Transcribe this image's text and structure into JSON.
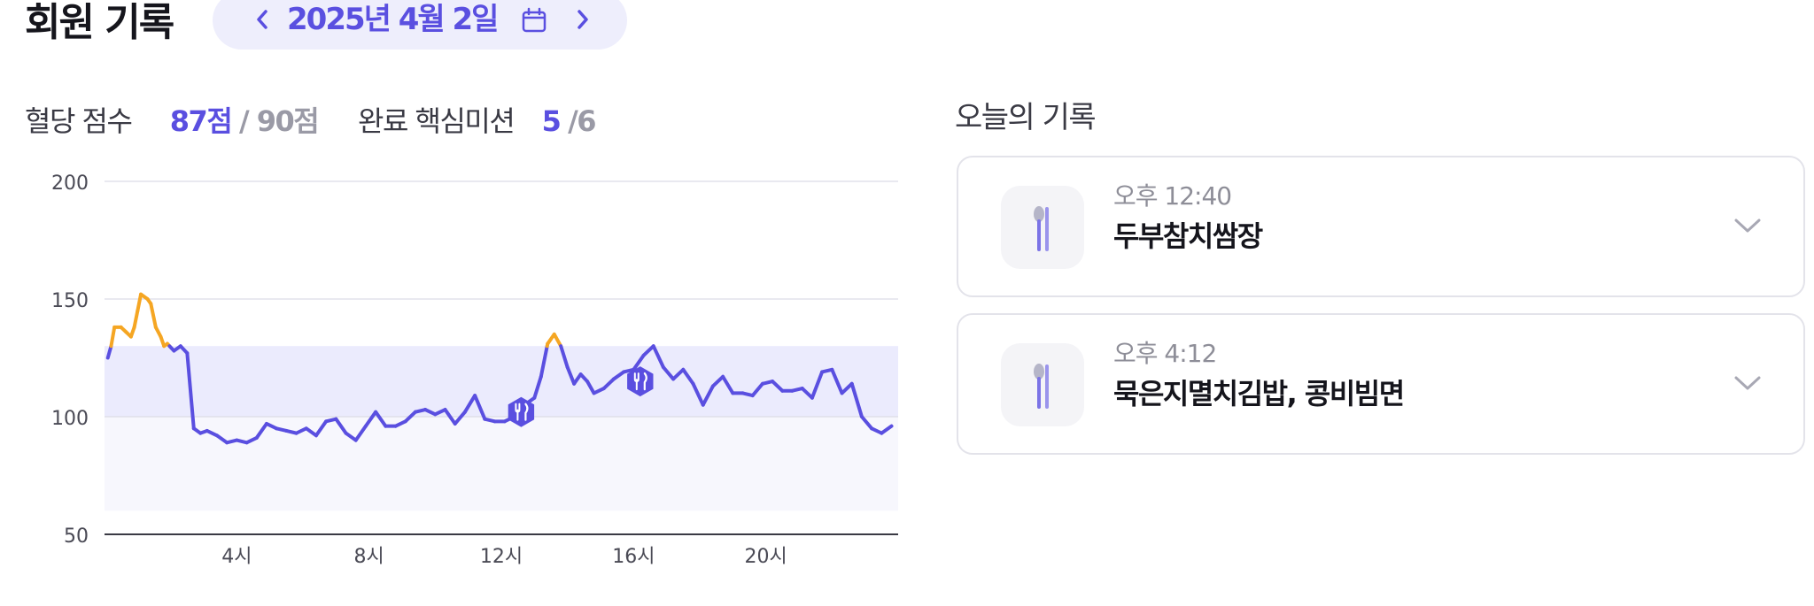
{
  "header": {
    "title": "회원 기록",
    "date_label": "2025년 4월 2일"
  },
  "stats": {
    "score_label": "혈당 점수",
    "score_value": "87점",
    "score_max": "/ 90점",
    "missions_label": "완료 핵심미션",
    "missions_value": "5",
    "missions_total": "/6"
  },
  "icons": {
    "prev": "chevron-left-icon",
    "next": "chevron-right-icon",
    "calendar": "calendar-icon",
    "meal": "fork-knife-icon",
    "expand": "chevron-down-icon"
  },
  "colors": {
    "accent": "#5a4fe0",
    "spike": "#f5a623",
    "target_band": "#ebebfd",
    "low_band": "#f7f7fd"
  },
  "chart_data": {
    "type": "line",
    "ylim": [
      50,
      200
    ],
    "yticks": [
      "200",
      "150",
      "100",
      "50"
    ],
    "xlim": [
      0,
      24
    ],
    "xticks": [
      {
        "x": 4,
        "label": "4시"
      },
      {
        "x": 8,
        "label": "8시"
      },
      {
        "x": 12,
        "label": "12시"
      },
      {
        "x": 16,
        "label": "16시"
      },
      {
        "x": 20,
        "label": "20시"
      }
    ],
    "target_range": [
      100,
      130
    ],
    "shaded_range": [
      60,
      100
    ],
    "spike_threshold": 130,
    "grid": true,
    "meal_markers": [
      {
        "x": 12.6,
        "y": 102
      },
      {
        "x": 16.2,
        "y": 115
      }
    ],
    "series": [
      {
        "x": [
          0.1,
          0.2,
          0.3,
          0.5,
          0.65,
          0.8,
          0.9,
          1.0,
          1.1,
          1.3,
          1.4,
          1.55,
          1.7,
          1.8,
          1.9,
          2.1,
          2.3,
          2.5,
          2.7,
          2.9,
          3.1,
          3.4,
          3.7,
          4.0,
          4.3,
          4.6,
          4.9,
          5.2,
          5.5,
          5.8,
          6.1,
          6.4,
          6.7,
          7.0,
          7.3,
          7.6,
          7.9,
          8.2,
          8.5,
          8.8,
          9.1,
          9.4,
          9.7,
          10.0,
          10.3,
          10.6,
          10.9,
          11.2,
          11.5,
          11.8,
          12.1,
          12.4,
          12.7,
          13.0,
          13.2,
          13.4,
          13.6,
          13.8,
          14.0,
          14.2,
          14.4,
          14.6,
          14.8,
          15.1,
          15.4,
          15.7,
          16.0,
          16.3,
          16.6,
          16.9,
          17.2,
          17.5,
          17.8,
          18.1,
          18.4,
          18.7,
          19.0,
          19.3,
          19.6,
          19.9,
          20.2,
          20.5,
          20.8,
          21.1,
          21.4,
          21.7,
          22.0,
          22.3,
          22.6,
          22.9,
          23.2,
          23.5,
          23.8
        ],
        "y": [
          125,
          130,
          138,
          138,
          136,
          134,
          138,
          145,
          152,
          150,
          148,
          138,
          134,
          130,
          131,
          128,
          130,
          127,
          95,
          93,
          94,
          92,
          89,
          90,
          89,
          91,
          97,
          95,
          94,
          93,
          95,
          92,
          98,
          99,
          93,
          90,
          96,
          102,
          96,
          96,
          98,
          102,
          103,
          101,
          103,
          97,
          102,
          109,
          99,
          98,
          98,
          100,
          105,
          108,
          117,
          131,
          135,
          130,
          121,
          114,
          118,
          115,
          110,
          112,
          116,
          119,
          120,
          126,
          130,
          121,
          116,
          120,
          114,
          105,
          113,
          117,
          110,
          110,
          109,
          114,
          115,
          111,
          111,
          112,
          108,
          119,
          120,
          110,
          114,
          100,
          95,
          93,
          96
        ]
      }
    ]
  },
  "records": {
    "title": "오늘의 기록",
    "items": [
      {
        "time": "오후 12:40",
        "meal": "두부참치쌈장"
      },
      {
        "time": "오후 4:12",
        "meal": "묵은지멸치김밥, 콩비빔면"
      }
    ]
  }
}
